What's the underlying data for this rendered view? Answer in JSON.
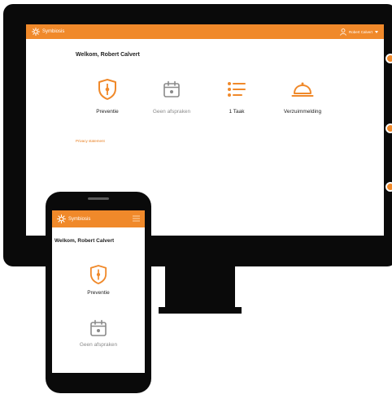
{
  "desktop": {
    "brand": "Symbiosis",
    "user_name": "Robert Calvert",
    "welcome": "Welkom, Robert Calvert",
    "tiles": [
      {
        "label": "Preventie",
        "icon": "shield-icon"
      },
      {
        "label": "Geen afspraken",
        "icon": "calendar-icon"
      },
      {
        "label": "1 Taak",
        "icon": "task-list-icon"
      },
      {
        "label": "Verzuimmelding",
        "icon": "service-bell-icon"
      }
    ],
    "privacy": "Privacy statement"
  },
  "mobile": {
    "brand": "Symbiosis",
    "welcome": "Welkom, Robert Calvert",
    "tiles": [
      {
        "label": "Preventie",
        "icon": "shield-icon"
      },
      {
        "label": "Geen afspraken",
        "icon": "calendar-icon"
      }
    ]
  },
  "colors": {
    "accent": "#f0892a",
    "text_dark": "#222222",
    "muted": "#8a8a8a",
    "device": "#0a0a0a"
  }
}
